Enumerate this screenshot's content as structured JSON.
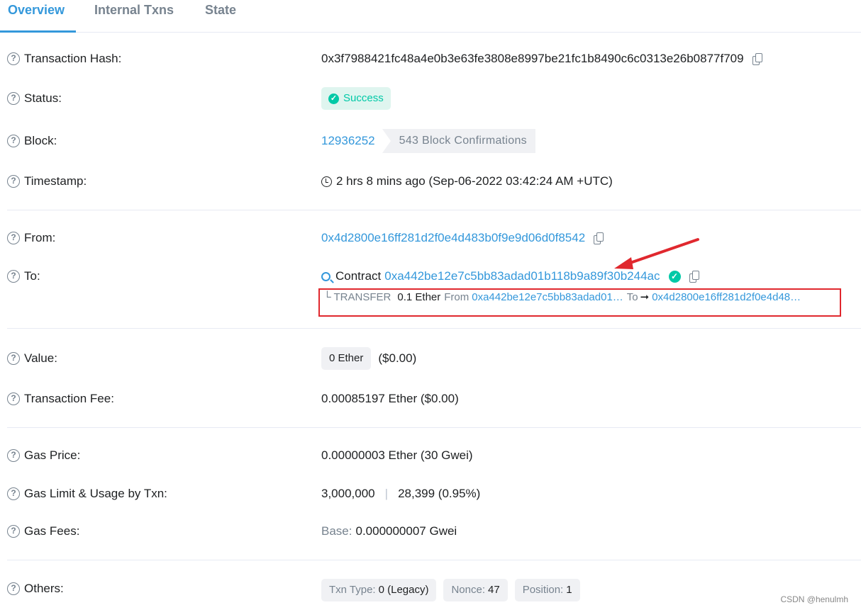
{
  "tabs": [
    {
      "label": "Overview"
    },
    {
      "label": "Internal Txns"
    },
    {
      "label": "State"
    }
  ],
  "labels": {
    "tx_hash": "Transaction Hash:",
    "status": "Status:",
    "block": "Block:",
    "timestamp": "Timestamp:",
    "from": "From:",
    "to": "To:",
    "value": "Value:",
    "tx_fee": "Transaction Fee:",
    "gas_price": "Gas Price:",
    "gas_limit": "Gas Limit & Usage by Txn:",
    "gas_fees": "Gas Fees:",
    "others": "Others:"
  },
  "tx_hash": "0x3f7988421fc48a4e0b3e63fe3808e8997be21fc1b8490c6c0313e26b0877f709",
  "status": "Success",
  "block": {
    "number": "12936252",
    "confirmations": "543 Block Confirmations"
  },
  "timestamp": "2 hrs 8 mins ago (Sep-06-2022 03:42:24 AM +UTC)",
  "from_address": "0x4d2800e16ff281d2f0e4d483b0f9e9d06d0f8542",
  "to": {
    "prefix": "Contract",
    "address": "0xa442be12e7c5bb83adad01b118b9a89f30b244ac"
  },
  "transfer": {
    "prefix": "└ TRANSFER",
    "amount": "0.1 Ether",
    "from_label": "From",
    "from_address": "0xa442be12e7c5bb83adad01…",
    "to_label": "To",
    "arrow": "➞",
    "to_address": "0x4d2800e16ff281d2f0e4d48…"
  },
  "value": {
    "amount": "0 Ether",
    "usd": "($0.00)"
  },
  "tx_fee": "0.00085197 Ether ($0.00)",
  "gas_price": "0.00000003 Ether (30 Gwei)",
  "gas_limit": {
    "limit": "3,000,000",
    "separator": "|",
    "usage": "28,399 (0.95%)"
  },
  "gas_fees": {
    "base_label": "Base:",
    "base_value": "0.000000007 Gwei"
  },
  "others": [
    {
      "label": "Txn Type:",
      "value": "0 (Legacy)"
    },
    {
      "label": "Nonce:",
      "value": "47"
    },
    {
      "label": "Position:",
      "value": "1"
    }
  ],
  "watermark": "CSDN @henulmh",
  "colors": {
    "link": "#3498db",
    "success": "#00c9a7",
    "highlight": "#e0282e"
  },
  "icons": [
    "question-icon",
    "copy-icon",
    "check-circle-icon",
    "clock-icon",
    "zoom-icon",
    "verified-icon",
    "red-arrow"
  ]
}
